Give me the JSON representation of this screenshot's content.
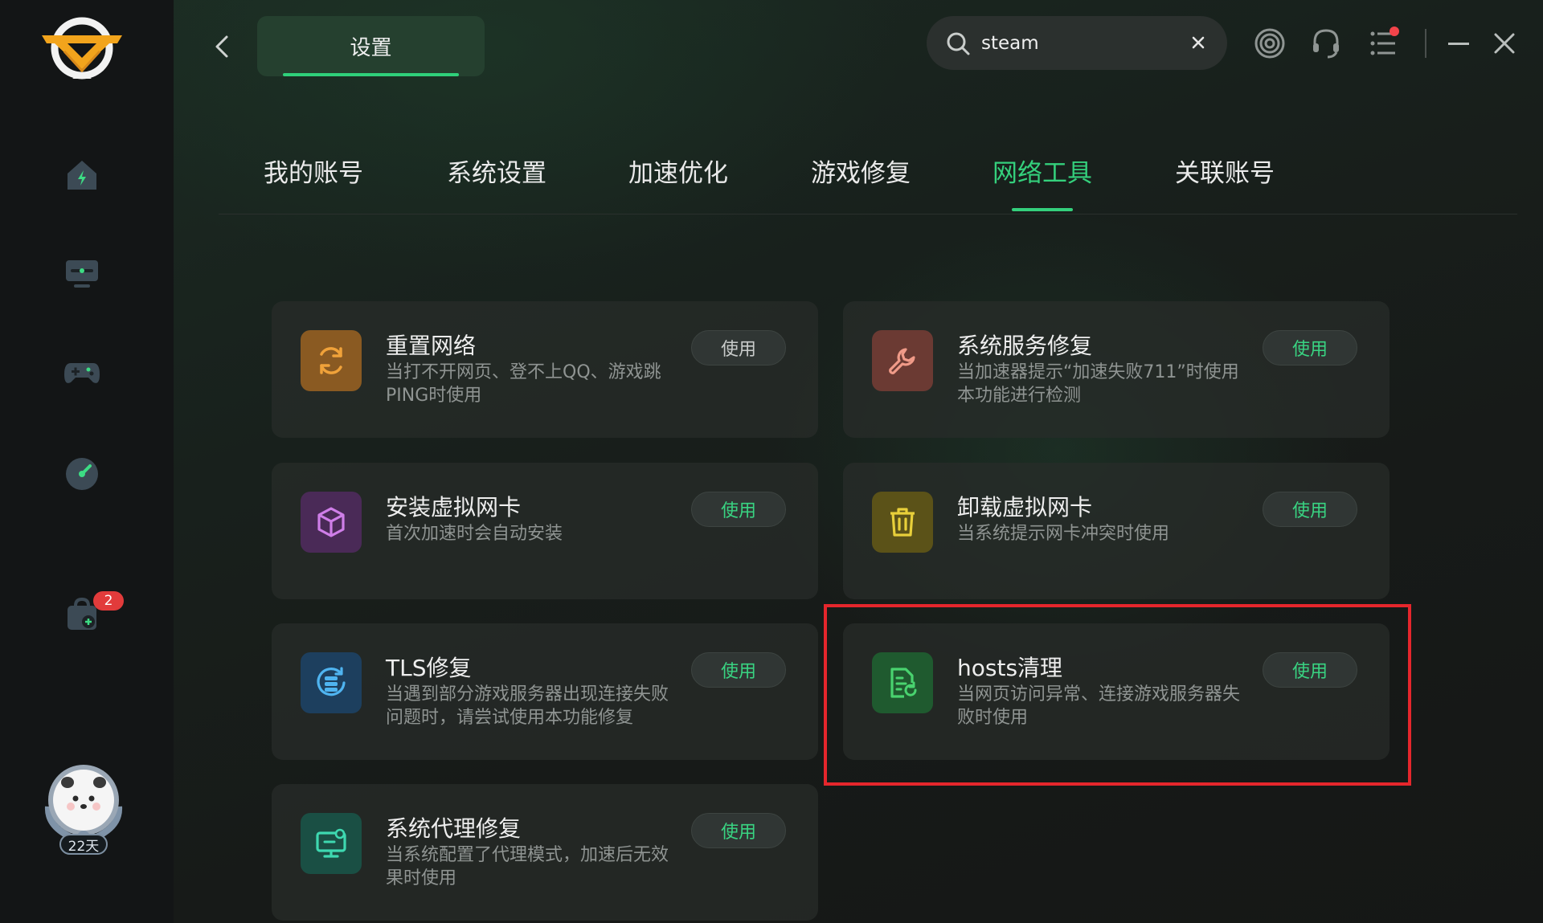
{
  "header": {
    "title": "设置",
    "search_value": "steam"
  },
  "sidebar": {
    "badge_count": "2",
    "membership_days": "22天"
  },
  "tabs": [
    {
      "label": "我的账号",
      "active": false
    },
    {
      "label": "系统设置",
      "active": false
    },
    {
      "label": "加速优化",
      "active": false
    },
    {
      "label": "游戏修复",
      "active": false
    },
    {
      "label": "网络工具",
      "active": true
    },
    {
      "label": "关联账号",
      "active": false
    }
  ],
  "tools": [
    {
      "name": "重置网络",
      "desc": "当打不开网页、登不上QQ、游戏跳PING时使用",
      "button": "使用",
      "icon": "refresh-icon",
      "icon_bg": "#8a5a22",
      "icon_color": "#f0a23a"
    },
    {
      "name": "系统服务修复",
      "desc": "当加速器提示“加速失败711”时使用本功能进行检测",
      "button": "使用",
      "icon": "wrench-icon",
      "icon_bg": "#6b3a33",
      "icon_color": "#f09a88"
    },
    {
      "name": "安装虚拟网卡",
      "desc": "首次加速时会自动安装",
      "button": "使用",
      "icon": "cube-icon",
      "icon_bg": "#4a2a57",
      "icon_color": "#cf7ee8"
    },
    {
      "name": "卸载虚拟网卡",
      "desc": "当系统提示网卡冲突时使用",
      "button": "使用",
      "icon": "trash-icon",
      "icon_bg": "#5b5218",
      "icon_color": "#e8cf3a"
    },
    {
      "name": "TLS修复",
      "desc": "当遇到部分游戏服务器出现连接失败问题时，请尝试使用本功能修复",
      "button": "使用",
      "icon": "database-sync-icon",
      "icon_bg": "#1d3f5e",
      "icon_color": "#4fb4f0"
    },
    {
      "name": "hosts清理",
      "desc": "当网页访问异常、连接游戏服务器失败时使用",
      "button": "使用",
      "icon": "document-sync-icon",
      "icon_bg": "#1f5a2f",
      "icon_color": "#49d36f"
    },
    {
      "name": "系统代理修复",
      "desc": "当系统配置了代理模式，加速后无效果时使用",
      "button": "使用",
      "icon": "monitor-icon",
      "icon_bg": "#1a4f44",
      "icon_color": "#3ed8b0"
    }
  ],
  "colors": {
    "accent": "#34d07c",
    "highlight_border": "#e5262c"
  }
}
